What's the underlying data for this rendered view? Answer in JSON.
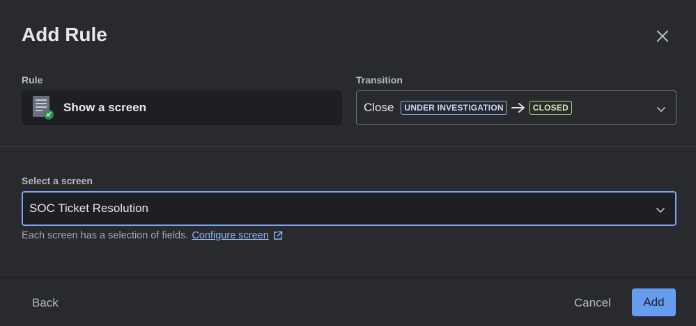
{
  "dialog": {
    "title": "Add Rule"
  },
  "rule": {
    "label": "Rule",
    "value": "Show a screen",
    "icon": "document-screen-icon"
  },
  "transition": {
    "label": "Transition",
    "name": "Close",
    "from_status": "UNDER INVESTIGATION",
    "to_status": "CLOSED"
  },
  "screen_select": {
    "label": "Select a screen",
    "value": "SOC Ticket Resolution",
    "helper_text": "Each screen has a selection of fields.",
    "helper_link": "Configure screen"
  },
  "footer": {
    "back_label": "Back",
    "cancel_label": "Cancel",
    "add_label": "Add"
  },
  "colors": {
    "background": "#282a2d",
    "accent": "#669df1",
    "status_blue": "#8fb8f6",
    "status_green": "#b3df72"
  }
}
